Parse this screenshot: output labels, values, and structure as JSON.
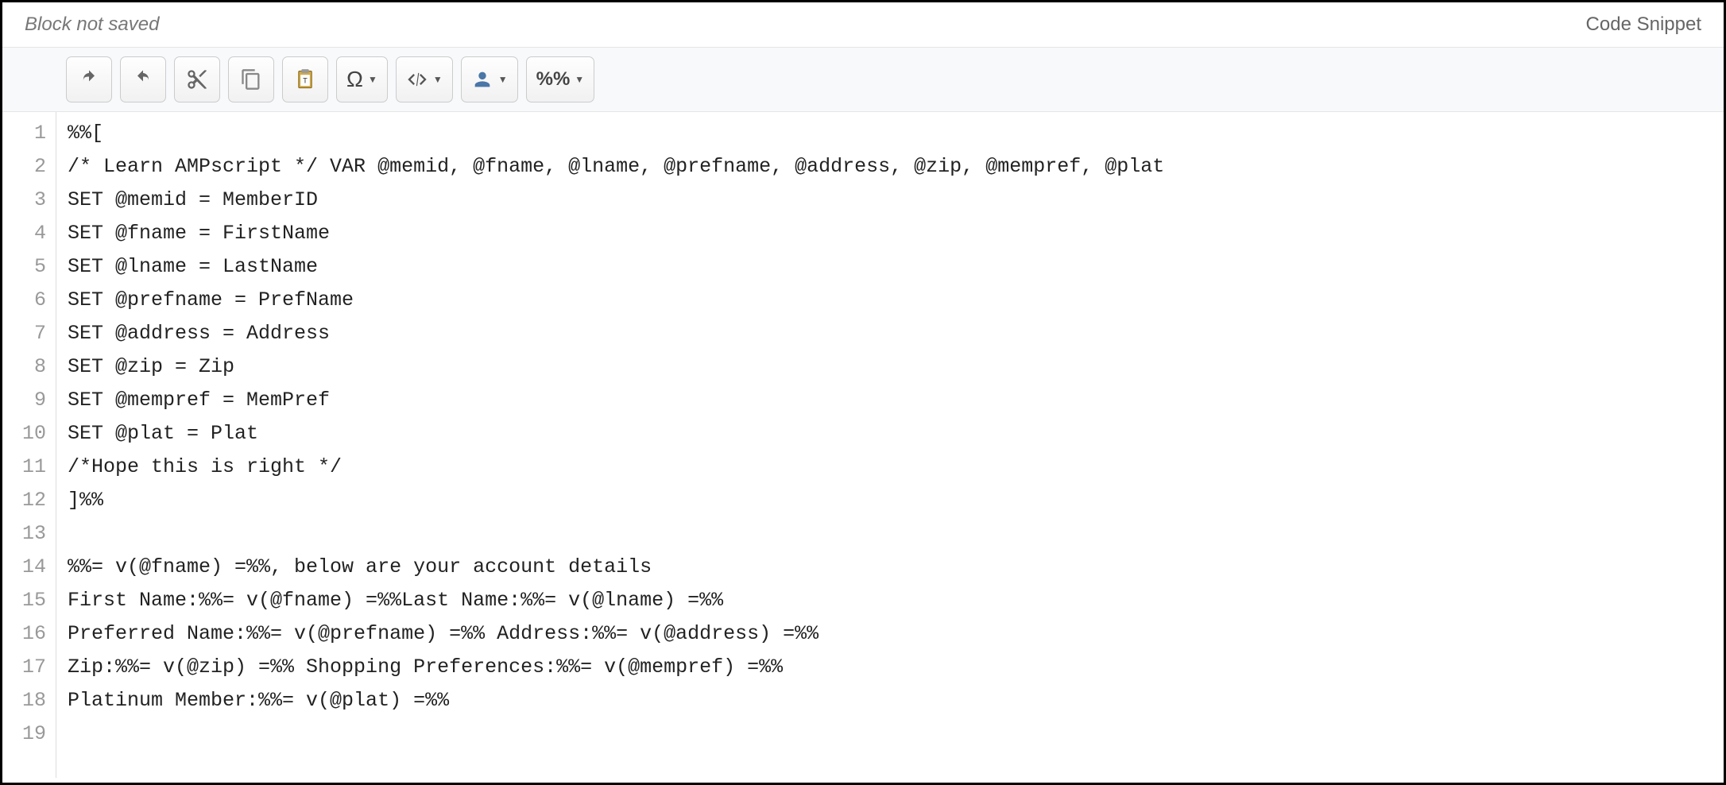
{
  "header": {
    "status": "Block not saved",
    "title": "Code Snippet"
  },
  "toolbar": {
    "omega_label": "Ω",
    "percent_label": "%%"
  },
  "code_lines": [
    "%%[",
    "/* Learn AMPscript */ VAR @memid, @fname, @lname, @prefname, @address, @zip, @mempref, @plat",
    "SET @memid = MemberID",
    "SET @fname = FirstName",
    "SET @lname = LastName",
    "SET @prefname = PrefName",
    "SET @address = Address",
    "SET @zip = Zip",
    "SET @mempref = MemPref",
    "SET @plat = Plat",
    "/*Hope this is right */",
    "]%%",
    "",
    "%%= v(@fname) =%%, below are your account details",
    "First Name:%%= v(@fname) =%%Last Name:%%= v(@lname) =%%",
    "Preferred Name:%%= v(@prefname) =%% Address:%%= v(@address) =%%",
    "Zip:%%= v(@zip) =%% Shopping Preferences:%%= v(@mempref) =%%",
    "Platinum Member:%%= v(@plat) =%%",
    ""
  ]
}
